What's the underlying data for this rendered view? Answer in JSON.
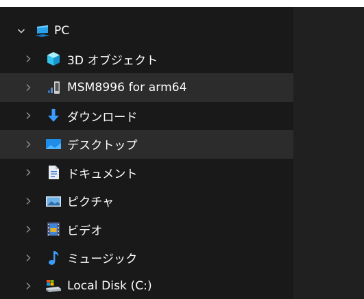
{
  "navigation": {
    "root": {
      "label": "PC",
      "icon": "computer-icon",
      "expanded": true
    },
    "items": [
      {
        "label": "3D オブジェクト",
        "icon": "3d-objects-icon",
        "selected": false
      },
      {
        "label": "MSM8996 for arm64",
        "icon": "phone-device-icon",
        "selected": true
      },
      {
        "label": "ダウンロード",
        "icon": "downloads-icon",
        "selected": false
      },
      {
        "label": "デスクトップ",
        "icon": "desktop-icon",
        "selected": true
      },
      {
        "label": "ドキュメント",
        "icon": "documents-icon",
        "selected": false
      },
      {
        "label": "ピクチャ",
        "icon": "pictures-icon",
        "selected": false
      },
      {
        "label": "ビデオ",
        "icon": "videos-icon",
        "selected": false
      },
      {
        "label": "ミュージック",
        "icon": "music-icon",
        "selected": false
      },
      {
        "label": "Local Disk (C:)",
        "icon": "local-disk-icon",
        "selected": false
      }
    ]
  },
  "colors": {
    "nav_background": "#191919",
    "content_background": "#202020",
    "selected_row": "#2c2c2c",
    "text": "#ffffff",
    "chevron": "#8a8a8a"
  }
}
